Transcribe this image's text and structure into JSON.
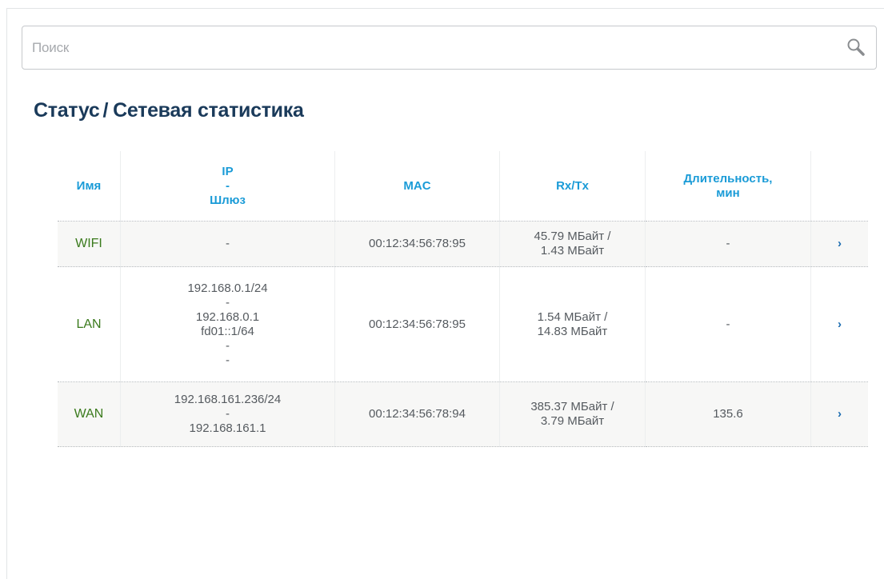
{
  "search": {
    "placeholder": "Поиск",
    "value": ""
  },
  "page": {
    "title_section": "Статус",
    "title_separator": "/",
    "title_page": "Сетевая статистика"
  },
  "table": {
    "headers": {
      "name": "Имя",
      "ip_line1": "IP",
      "ip_line2": "-",
      "ip_line3": "Шлюз",
      "mac": "MAC",
      "rxtx": "Rx/Tx",
      "duration_line1": "Длительность,",
      "duration_line2": "мин"
    },
    "rows": [
      {
        "name": "WIFI",
        "ip_lines": [
          "-"
        ],
        "mac": "00:12:34:56:78:95",
        "rx": "45.79 МБайт /",
        "tx": "1.43 МБайт",
        "duration": "-"
      },
      {
        "name": "LAN",
        "ip_lines": [
          "192.168.0.1/24",
          "-",
          "192.168.0.1",
          "fd01::1/64",
          "-",
          "-"
        ],
        "mac": "00:12:34:56:78:95",
        "rx": "1.54 МБайт /",
        "tx": "14.83 МБайт",
        "duration": "-"
      },
      {
        "name": "WAN",
        "ip_lines": [
          "192.168.161.236/24",
          "-",
          "192.168.161.1"
        ],
        "mac": "00:12:34:56:78:94",
        "rx": "385.37 МБайт /",
        "tx": "3.79 МБайт",
        "duration": "135.6"
      }
    ]
  },
  "colors": {
    "title": "#1a3a5a",
    "header": "#1a9bd7",
    "name": "#3a7a1c",
    "arrow": "#1a6bb0"
  },
  "icons": {
    "search": "search-icon",
    "row_arrow": "chevron-right-icon"
  }
}
